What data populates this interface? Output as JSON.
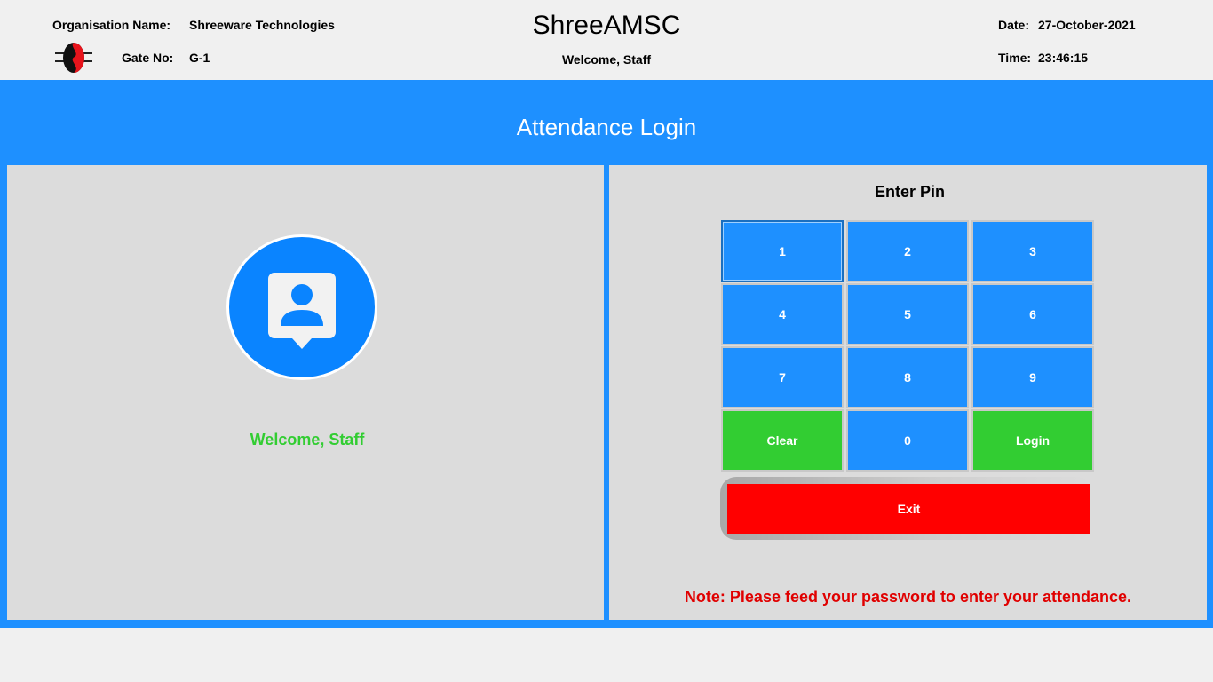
{
  "header": {
    "org_label": "Organisation Name:",
    "org_value": "Shreeware Technologies",
    "gate_label": "Gate No:",
    "gate_value": "G-1",
    "app_title": "ShreeAMSC",
    "welcome": "Welcome, Staff",
    "date_label": "Date:",
    "date_value": "27-October-2021",
    "time_label": "Time:",
    "time_value": "23:46:15"
  },
  "page_title": "Attendance Login",
  "left": {
    "welcome": "Welcome, Staff",
    "avatar_icon": "user-badge-icon"
  },
  "right": {
    "heading": "Enter Pin",
    "keys": [
      "1",
      "2",
      "3",
      "4",
      "5",
      "6",
      "7",
      "8",
      "9",
      "Clear",
      "0",
      "Login"
    ],
    "exit": "Exit",
    "note": "Note: Please feed your password to enter your attendance."
  },
  "colors": {
    "accent": "#1e90ff",
    "green": "#32cd32",
    "red": "#ff0000"
  }
}
